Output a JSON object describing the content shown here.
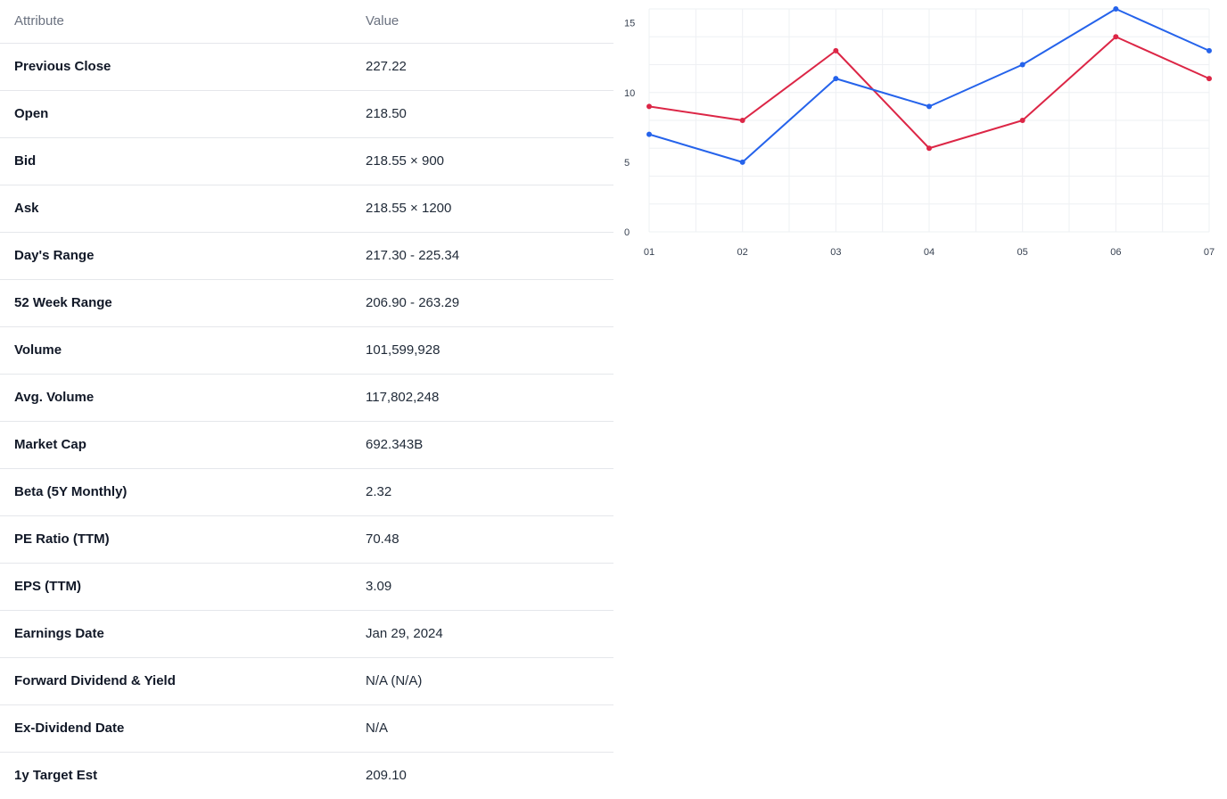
{
  "table": {
    "headers": {
      "attribute": "Attribute",
      "value": "Value"
    },
    "rows": [
      {
        "attribute": "Previous Close",
        "value": "227.22"
      },
      {
        "attribute": "Open",
        "value": "218.50"
      },
      {
        "attribute": "Bid",
        "value": "218.55 × 900"
      },
      {
        "attribute": "Ask",
        "value": "218.55 × 1200"
      },
      {
        "attribute": "Day's Range",
        "value": "217.30 - 225.34"
      },
      {
        "attribute": "52 Week Range",
        "value": "206.90 - 263.29"
      },
      {
        "attribute": "Volume",
        "value": "101,599,928"
      },
      {
        "attribute": "Avg. Volume",
        "value": "117,802,248"
      },
      {
        "attribute": "Market Cap",
        "value": "692.343B"
      },
      {
        "attribute": "Beta (5Y Monthly)",
        "value": "2.32"
      },
      {
        "attribute": "PE Ratio (TTM)",
        "value": "70.48"
      },
      {
        "attribute": "EPS (TTM)",
        "value": "3.09"
      },
      {
        "attribute": "Earnings Date",
        "value": "Jan 29, 2024"
      },
      {
        "attribute": "Forward Dividend & Yield",
        "value": "N/A (N/A)"
      },
      {
        "attribute": "Ex-Dividend Date",
        "value": "N/A"
      },
      {
        "attribute": "1y Target Est",
        "value": "209.10"
      }
    ]
  },
  "chart_data": {
    "type": "line",
    "x": [
      "01",
      "02",
      "03",
      "04",
      "05",
      "06",
      "07"
    ],
    "series": [
      {
        "values": [
          7,
          5,
          11,
          9,
          12,
          16,
          13
        ],
        "color": "#2563eb"
      },
      {
        "values": [
          9,
          8,
          13,
          6,
          8,
          14,
          11
        ],
        "color": "#dc2646"
      }
    ],
    "yticks": [
      0,
      5,
      10,
      15
    ],
    "ylim": [
      0,
      16
    ],
    "grid": true,
    "legend": "none"
  }
}
